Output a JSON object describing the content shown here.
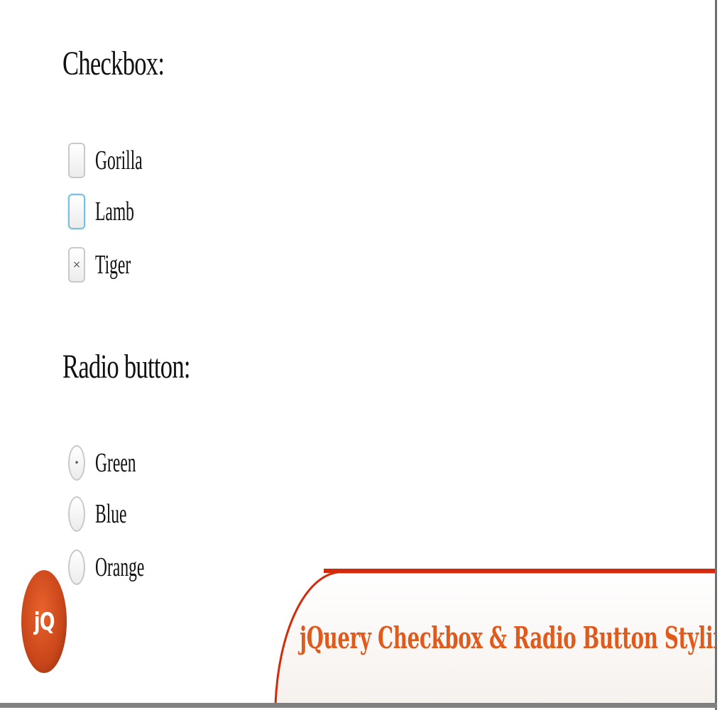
{
  "checkbox_section": {
    "heading": "Checkbox:",
    "items": [
      {
        "label": "Gorilla",
        "checked": false,
        "focused": false,
        "mark": ""
      },
      {
        "label": "Lamb",
        "checked": false,
        "focused": true,
        "mark": ""
      },
      {
        "label": "Tiger",
        "checked": true,
        "focused": false,
        "mark": "×"
      }
    ]
  },
  "radio_section": {
    "heading": "Radio button:",
    "items": [
      {
        "label": "Green",
        "selected": true,
        "mark": "•"
      },
      {
        "label": "Blue",
        "selected": false,
        "mark": ""
      },
      {
        "label": "Orange",
        "selected": false,
        "mark": ""
      }
    ]
  },
  "logo": {
    "text": "jQ",
    "icon": "jquery-logo-icon",
    "color": "#c9461a"
  },
  "banner": {
    "title": "jQuery Checkbox & Radio Button Styling",
    "accent_color": "#d42a0c",
    "title_color": "#e05a1c"
  }
}
